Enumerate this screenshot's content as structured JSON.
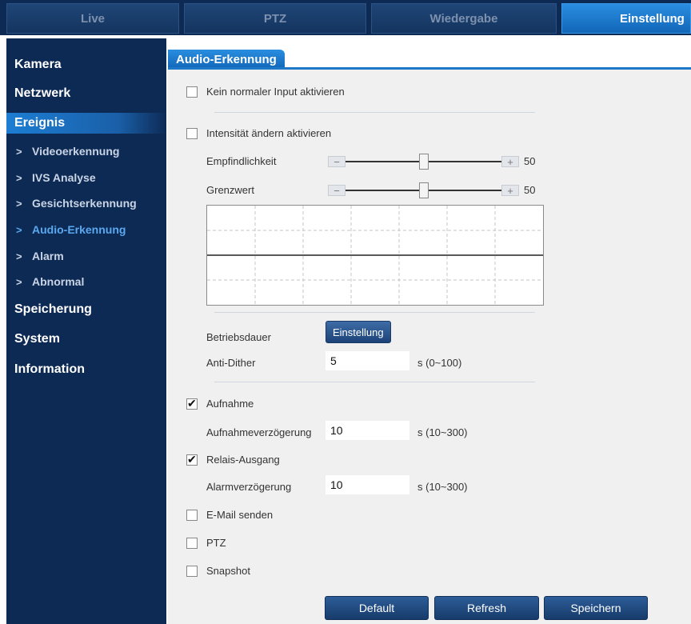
{
  "topnav": {
    "tabs": [
      {
        "label": "Live"
      },
      {
        "label": "PTZ"
      },
      {
        "label": "Wiedergabe"
      },
      {
        "label": "Einstellung"
      }
    ]
  },
  "sidebar": {
    "kamera": "Kamera",
    "netzwerk": "Netzwerk",
    "ereignis": "Ereignis",
    "sub": {
      "video": "Videoerkennung",
      "ivs": "IVS Analyse",
      "gesicht": "Gesichtserkennung",
      "audio": "Audio-Erkennung",
      "alarm": "Alarm",
      "abnormal": "Abnormal"
    },
    "speicherung": "Speicherung",
    "system": "System",
    "information": "Information"
  },
  "content": {
    "title": "Audio-Erkennung",
    "input_abnormal": {
      "label": "Kein normaler Input aktivieren",
      "checked": false
    },
    "intensity": {
      "label": "Intensität ändern aktivieren",
      "checked": false
    },
    "sensitivity": {
      "label": "Empfindlichkeit",
      "value": "50"
    },
    "threshold": {
      "label": "Grenzwert",
      "value": "50"
    },
    "schedule": {
      "label": "Betriebsdauer",
      "button": "Einstellung"
    },
    "anti_dither": {
      "label": "Anti-Dither",
      "value": "5",
      "unit": "s (0~100)"
    },
    "record": {
      "label": "Aufnahme",
      "checked": true
    },
    "record_delay": {
      "label": "Aufnahmeverzögerung",
      "value": "10",
      "unit": "s (10~300)"
    },
    "relay": {
      "label": "Relais-Ausgang",
      "checked": true
    },
    "alarm_delay": {
      "label": "Alarmverzögerung",
      "value": "10",
      "unit": "s (10~300)"
    },
    "email": {
      "label": "E-Mail senden",
      "checked": false
    },
    "ptz": {
      "label": "PTZ",
      "checked": false
    },
    "snapshot": {
      "label": "Snapshot",
      "checked": false
    }
  },
  "footer": {
    "default": "Default",
    "refresh": "Refresh",
    "save": "Speichern"
  }
}
